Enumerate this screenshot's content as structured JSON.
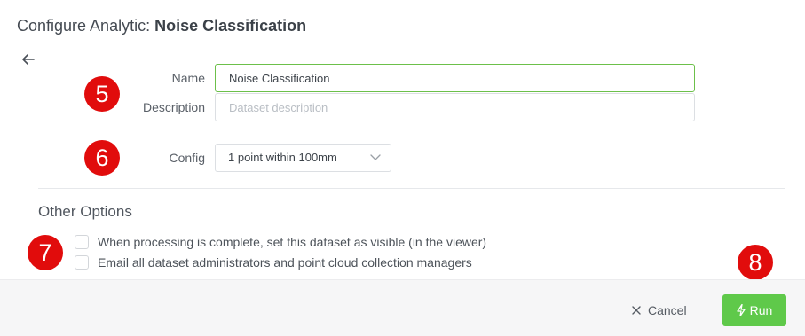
{
  "header": {
    "title_prefix": "Configure Analytic: ",
    "title_name": "Noise Classification"
  },
  "icons": {
    "back": "arrow-left-icon",
    "select_caret": "chevron-down-icon",
    "cancel": "close-icon",
    "run": "bolt-icon"
  },
  "markers": {
    "m5": "5",
    "m6": "6",
    "m7": "7",
    "m8": "8"
  },
  "form": {
    "name_label": "Name",
    "name_value": "Noise Classification",
    "description_label": "Description",
    "description_placeholder": "Dataset description",
    "config_label": "Config",
    "config_value": "1 point within 100mm"
  },
  "other_options": {
    "heading": "Other Options",
    "options": [
      {
        "label": "When processing is complete, set this dataset as visible (in the viewer)",
        "checked": false
      },
      {
        "label": "Email all dataset administrators and point cloud collection managers",
        "checked": false
      }
    ]
  },
  "footer": {
    "cancel_label": "Cancel",
    "run_label": "Run"
  },
  "colors": {
    "accent_green": "#5fc94a",
    "focus_border": "#6cc04a",
    "marker_red": "#e10c0c"
  }
}
